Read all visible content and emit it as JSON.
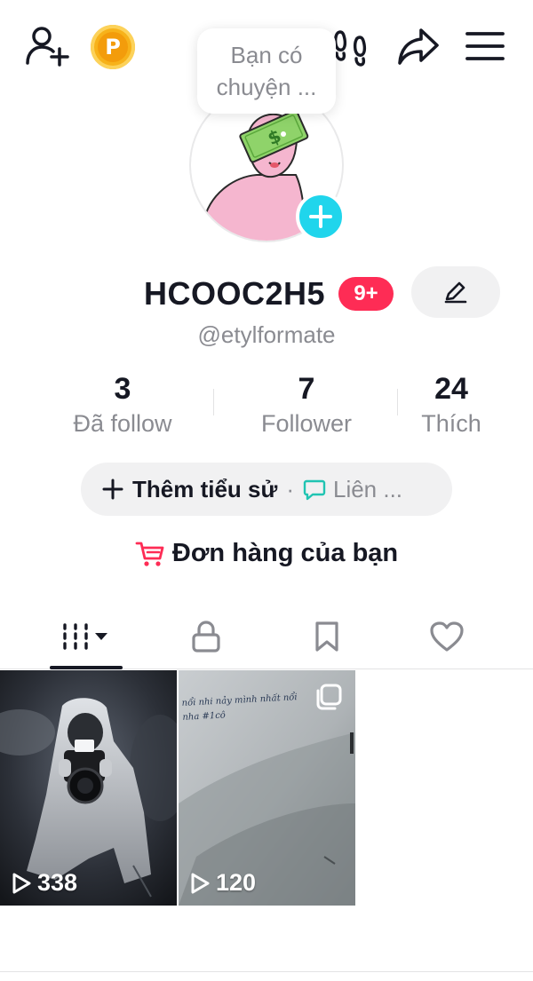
{
  "topbar": {
    "add_friend_icon": "person-add-icon",
    "coin_icon": "coin-icon",
    "coin_letter": "P",
    "footprint_icon": "footprints-icon",
    "share_icon": "share-arrow-icon",
    "menu_icon": "hamburger-menu-icon"
  },
  "bubble": {
    "line1": "Bạn có",
    "line2": "chuyện ..."
  },
  "profile": {
    "display_name": "HCOOC2H5",
    "badge": "9+",
    "handle": "@etylformate",
    "edit_icon": "pencil-icon"
  },
  "stats": [
    {
      "value": "3",
      "label": "Đã follow"
    },
    {
      "value": "7",
      "label": "Follower"
    },
    {
      "value": "24",
      "label": "Thích"
    }
  ],
  "bio": {
    "add_label": "Thêm tiểu sử",
    "separator": "·",
    "link_label": "Liên ..."
  },
  "orders": {
    "label": "Đơn hàng của bạn",
    "icon": "shopping-cart-icon"
  },
  "tabs": [
    {
      "name": "videos-grid-tab",
      "icon": "grid-icon"
    },
    {
      "name": "private-tab",
      "icon": "lock-icon"
    },
    {
      "name": "saved-tab",
      "icon": "bookmark-icon"
    },
    {
      "name": "liked-tab",
      "icon": "heart-icon"
    }
  ],
  "videos": [
    {
      "views": "338"
    },
    {
      "views": "120",
      "caption": "nổi nhi nảy mình nhất nổi nha #1cô"
    }
  ],
  "colors": {
    "accent_red": "#fe2c55",
    "plus_cyan": "#20d5ec",
    "coin_gold": "#f7b21a",
    "cart_red": "#fe2c55",
    "message_teal": "#20c4b2"
  }
}
